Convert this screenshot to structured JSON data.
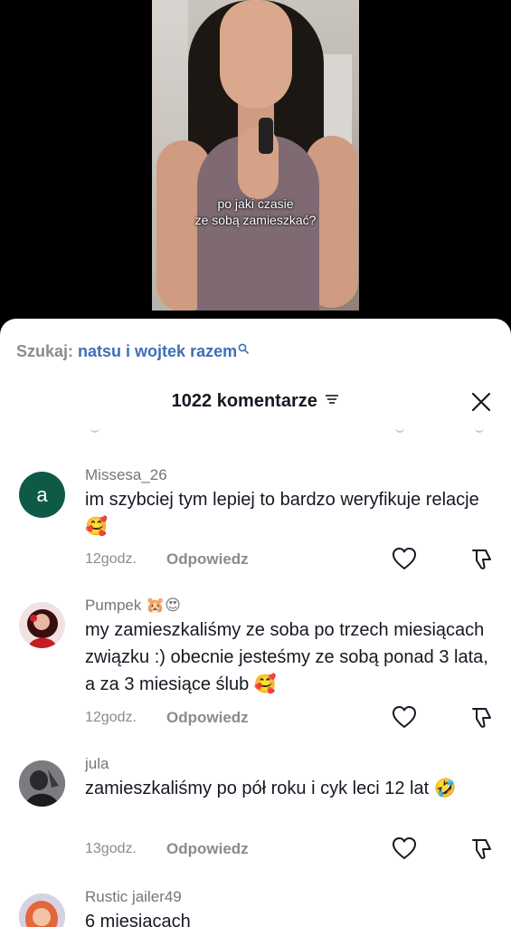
{
  "video": {
    "caption_line1": "po jaki czasie",
    "caption_line2": "ze sobą zamieszkać?"
  },
  "search": {
    "prefix": "Szukaj:",
    "term": "natsu i wojtek razem",
    "icon": "search-icon"
  },
  "header": {
    "title": "1022 komentarze",
    "sort_icon": "sort-icon",
    "close_icon": "close-icon"
  },
  "comments": [
    {
      "username": "Missesa_26",
      "avatar_letter": "a",
      "text": "im szybciej tym lepiej to bardzo weryfikuje relacje 🥰",
      "time": "12godz.",
      "reply_label": "Odpowiedz"
    },
    {
      "username": "Pumpek 🐹😍",
      "text": "my zamieszkaliśmy ze soba po trzech miesiącach związku :) obecnie jesteśmy ze sobą ponad 3 lata, a za 3 miesiące ślub 🥰",
      "time": "12godz.",
      "reply_label": "Odpowiedz"
    },
    {
      "username": "jula",
      "text": "zamieszkaliśmy po pół roku i cyk leci 12 lat 🤣",
      "time": "13godz.",
      "reply_label": "Odpowiedz"
    },
    {
      "username": "Rustic jailer49",
      "text": "6 miesiącach"
    }
  ],
  "colors": {
    "accent_link": "#3f6fb5",
    "avatar_a_bg": "#0f5a47",
    "text_primary": "#161823",
    "text_secondary": "#8a8b91"
  }
}
